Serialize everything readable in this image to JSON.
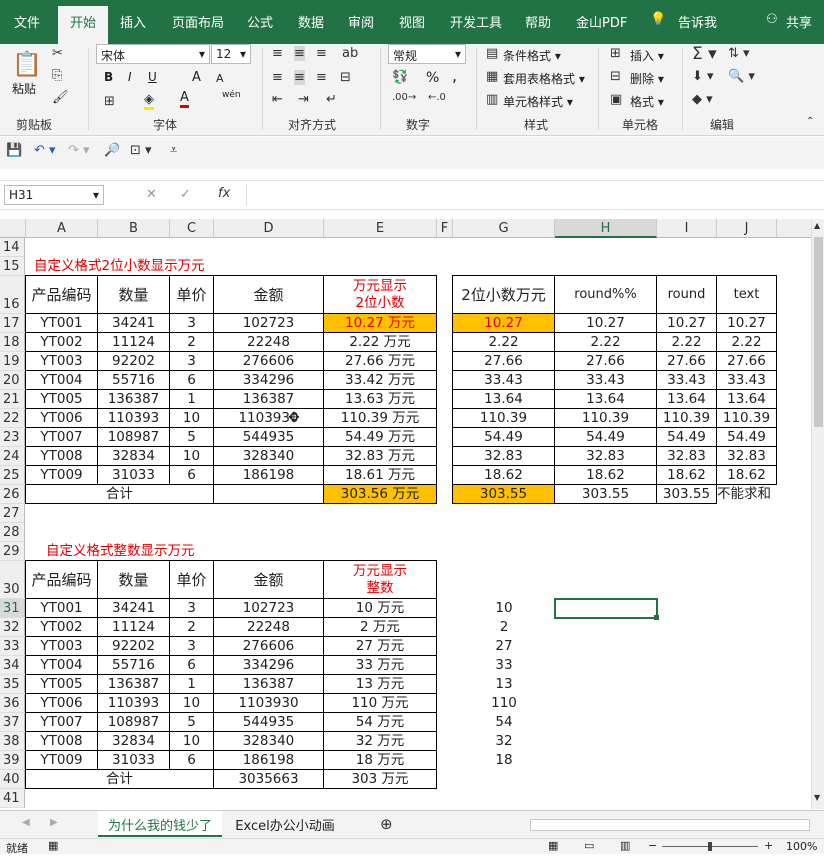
{
  "ribbon_tabs": [
    "文件",
    "开始",
    "插入",
    "页面布局",
    "公式",
    "数据",
    "审阅",
    "视图",
    "开发工具",
    "帮助",
    "金山PDF"
  ],
  "tell_me": "告诉我",
  "share": "共享",
  "groups": {
    "clipboard": "剪贴板",
    "font": "字体",
    "alignment": "对齐方式",
    "number": "数字",
    "styles": "样式",
    "cells": "单元格",
    "editing": "编辑"
  },
  "clipboard": {
    "paste": "粘贴"
  },
  "font": {
    "name": "宋体",
    "size": "12",
    "bold": "B",
    "italic": "I",
    "underline": "U",
    "grow": "A",
    "shrink": "A",
    "wen": "wén"
  },
  "number": {
    "format": "常规",
    "percent": "%",
    "comma": ","
  },
  "styles": {
    "conditional": "条件格式",
    "table": "套用表格格式",
    "cell": "单元格样式"
  },
  "cells": {
    "insert": "插入",
    "delete": "删除",
    "format": "格式"
  },
  "formula_bar": {
    "name_box": "H31",
    "fx": "fx",
    "cancel": "✕",
    "confirm": "✓"
  },
  "columns": [
    "A",
    "B",
    "C",
    "D",
    "E",
    "F",
    "G",
    "H",
    "I",
    "J"
  ],
  "rows": [
    "14",
    "15",
    "16",
    "17",
    "18",
    "19",
    "20",
    "21",
    "22",
    "23",
    "24",
    "25",
    "26",
    "27",
    "28",
    "29",
    "30",
    "31",
    "32",
    "33",
    "34",
    "35",
    "36",
    "37",
    "38",
    "39",
    "40",
    "41"
  ],
  "sec1": {
    "title": "自定义格式2位小数显示万元",
    "headers": [
      "产品编码",
      "数量",
      "单价",
      "金额"
    ],
    "header_e": [
      "万元显示",
      "2位小数"
    ],
    "headers_right": [
      "2位小数万元",
      "round%%",
      "round",
      "text"
    ],
    "data": [
      [
        "YT001",
        "34241",
        "3",
        "102723",
        "10.27 万元",
        "10.27",
        "10.27",
        "10.27",
        "10.27"
      ],
      [
        "YT002",
        "11124",
        "2",
        "22248",
        "2.22 万元",
        "2.22",
        "2.22",
        "2.22",
        "2.22"
      ],
      [
        "YT003",
        "92202",
        "3",
        "276606",
        "27.66 万元",
        "27.66",
        "27.66",
        "27.66",
        "27.66"
      ],
      [
        "YT004",
        "55716",
        "6",
        "334296",
        "33.42 万元",
        "33.43",
        "33.43",
        "33.43",
        "33.43"
      ],
      [
        "YT005",
        "136387",
        "1",
        "136387",
        "13.63 万元",
        "13.64",
        "13.64",
        "13.64",
        "13.64"
      ],
      [
        "YT006",
        "110393",
        "10",
        "1103930",
        "110.39 万元",
        "110.39",
        "110.39",
        "110.39",
        "110.39"
      ],
      [
        "YT007",
        "108987",
        "5",
        "544935",
        "54.49 万元",
        "54.49",
        "54.49",
        "54.49",
        "54.49"
      ],
      [
        "YT008",
        "32834",
        "10",
        "328340",
        "32.83 万元",
        "32.83",
        "32.83",
        "32.83",
        "32.83"
      ],
      [
        "YT009",
        "31033",
        "6",
        "186198",
        "18.61 万元",
        "18.62",
        "18.62",
        "18.62",
        "18.62"
      ]
    ],
    "total": [
      "合计",
      "",
      "303.56 万元",
      "303.55",
      "303.55",
      "303.55",
      "不能求和"
    ]
  },
  "sec2": {
    "title": "自定义格式整数显示万元",
    "headers": [
      "产品编码",
      "数量",
      "单价",
      "金额"
    ],
    "header_e": [
      "万元显示",
      "整数"
    ],
    "data": [
      [
        "YT001",
        "34241",
        "3",
        "102723",
        "10 万元",
        "10"
      ],
      [
        "YT002",
        "11124",
        "2",
        "22248",
        "2 万元",
        "2"
      ],
      [
        "YT003",
        "92202",
        "3",
        "276606",
        "27 万元",
        "27"
      ],
      [
        "YT004",
        "55716",
        "6",
        "334296",
        "33 万元",
        "33"
      ],
      [
        "YT005",
        "136387",
        "1",
        "136387",
        "13 万元",
        "13"
      ],
      [
        "YT006",
        "110393",
        "10",
        "1103930",
        "110 万元",
        "110"
      ],
      [
        "YT007",
        "108987",
        "5",
        "544935",
        "54 万元",
        "54"
      ],
      [
        "YT008",
        "32834",
        "10",
        "328340",
        "32 万元",
        "32"
      ],
      [
        "YT009",
        "31033",
        "6",
        "186198",
        "18 万元",
        "18"
      ]
    ],
    "total": [
      "合计",
      "3035663",
      "303 万元"
    ]
  },
  "sheets": [
    "为什么我的钱少了",
    "Excel办公小动画"
  ],
  "status": {
    "ready": "就绪",
    "zoom": "100%"
  },
  "colors": {
    "green": "#217346",
    "red": "#e00000",
    "orange": "#ffc000"
  }
}
